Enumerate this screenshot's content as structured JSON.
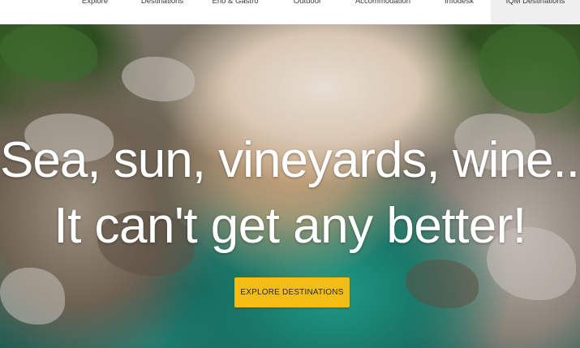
{
  "nav": {
    "items": [
      {
        "label": "Explore"
      },
      {
        "label": "Destinations"
      },
      {
        "label": "Eno & Gastro"
      },
      {
        "label": "Outdoor"
      },
      {
        "label": "Accommodation"
      },
      {
        "label": "Infodesk"
      },
      {
        "label": "IQM Destinations"
      }
    ],
    "active_item": "IQM Destinations"
  },
  "hero": {
    "headline_line1": "Sea, sun, vineyards, wine...",
    "headline_line2": "It can't get any better!",
    "cta_label": "EXPLORE DESTINATIONS",
    "cta_color": "#f2bd14"
  }
}
